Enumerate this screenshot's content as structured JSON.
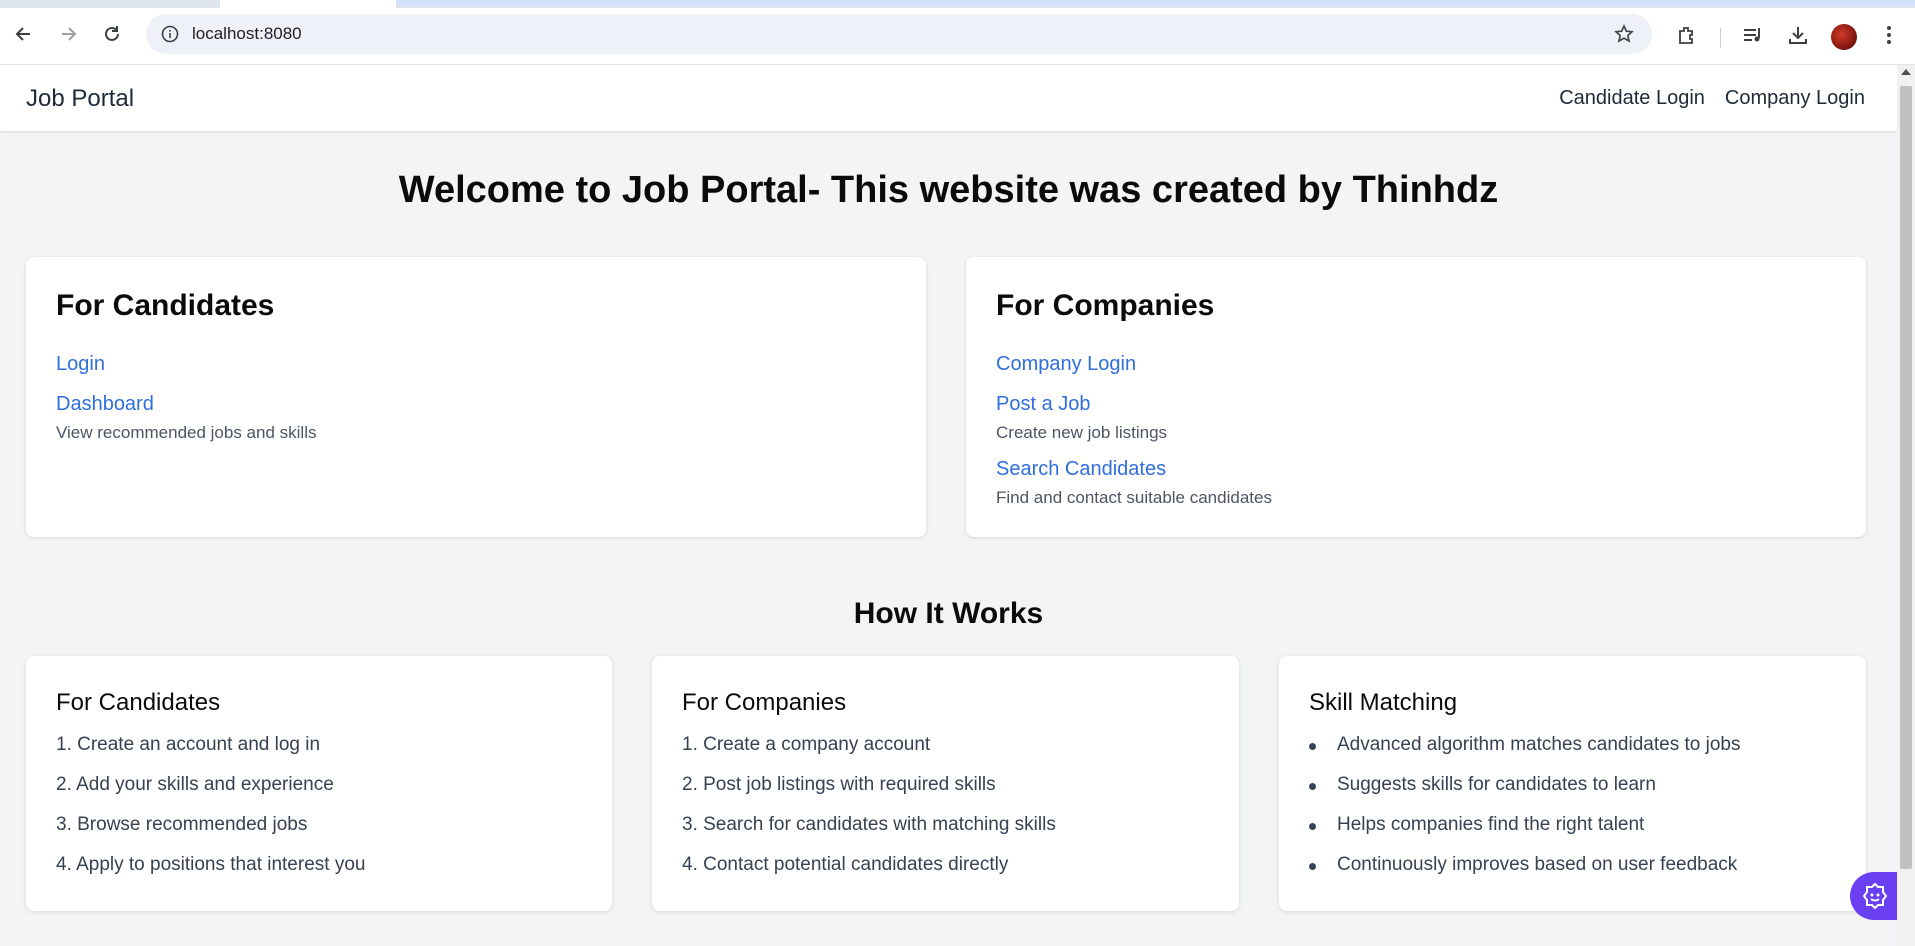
{
  "browser": {
    "url": "localhost:8080"
  },
  "nav": {
    "brand": "Job Portal",
    "links": [
      "Candidate Login",
      "Company Login"
    ]
  },
  "hero": {
    "title": "Welcome to Job Portal- This website was created by Thinhdz"
  },
  "cards": {
    "candidates": {
      "title": "For Candidates",
      "login": "Login",
      "dashboard": "Dashboard",
      "dashboard_desc": "View recommended jobs and skills"
    },
    "companies": {
      "title": "For Companies",
      "company_login": "Company Login",
      "post_job": "Post a Job",
      "post_job_desc": "Create new job listings",
      "search": "Search Candidates",
      "search_desc": "Find and contact suitable candidates"
    }
  },
  "how": {
    "title": "How It Works",
    "candidates": {
      "title": "For Candidates",
      "steps": [
        "1. Create an account and log in",
        "2. Add your skills and experience",
        "3. Browse recommended jobs",
        "4. Apply to positions that interest you"
      ]
    },
    "companies": {
      "title": "For Companies",
      "steps": [
        "1. Create a company account",
        "2. Post job listings with required skills",
        "3. Search for candidates with matching skills",
        "4. Contact potential candidates directly"
      ]
    },
    "skills": {
      "title": "Skill Matching",
      "items": [
        "Advanced algorithm matches candidates to jobs",
        "Suggests skills for candidates to learn",
        "Helps companies find the right talent",
        "Continuously improves based on user feedback"
      ]
    }
  },
  "colors": {
    "link": "#2f6fdc",
    "floating_button": "#6b3ff2",
    "page_background": "#f3f4f6"
  }
}
